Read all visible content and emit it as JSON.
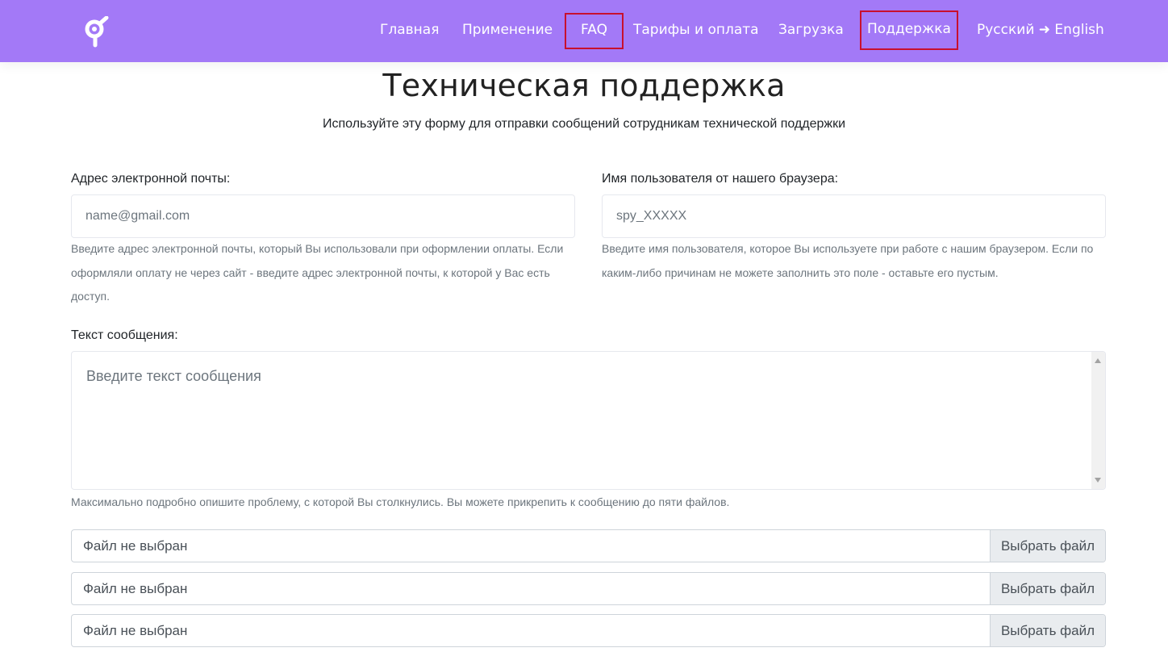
{
  "header": {
    "logo_icon": "flower-logo-icon",
    "nav": {
      "home": "Главная",
      "usage": "Применение",
      "faq": "FAQ",
      "tariffs": "Тарифы и оплата",
      "download": "Загрузка",
      "support": "Поддержка",
      "language": "Русский ➜ English"
    },
    "bar_color": "#a379f7",
    "highlight_color": "#c8102e"
  },
  "page": {
    "title": "Техническая поддержка",
    "subtitle": "Используйте эту форму для отправки сообщений сотрудникам технической поддержки"
  },
  "form": {
    "email": {
      "label": "Адрес электронной почты:",
      "placeholder": "name@gmail.com",
      "help": "Введите адрес электронной почты, который Вы использовали при оформлении оплаты. Если оформляли оплату не через сайт - введите адрес электронной почты, к которой у Вас есть доступ."
    },
    "username": {
      "label": "Имя пользователя от нашего браузера:",
      "placeholder": "spy_XXXXX",
      "help": "Введите имя пользователя, которое Вы используете при работе с нашим браузером. Если по каким-либо причинам не можете заполнить это поле - оставьте его пустым."
    },
    "message": {
      "label": "Текст сообщения:",
      "placeholder": "Введите текст сообщения",
      "help": "Максимально подробно опишите проблему, с которой Вы столкнулись. Вы можете прикрепить к сообщению до пяти файлов."
    },
    "files": [
      {
        "status": "Файл не выбран",
        "button": "Выбрать файл"
      },
      {
        "status": "Файл не выбран",
        "button": "Выбрать файл"
      },
      {
        "status": "Файл не выбран",
        "button": "Выбрать файл"
      }
    ]
  }
}
